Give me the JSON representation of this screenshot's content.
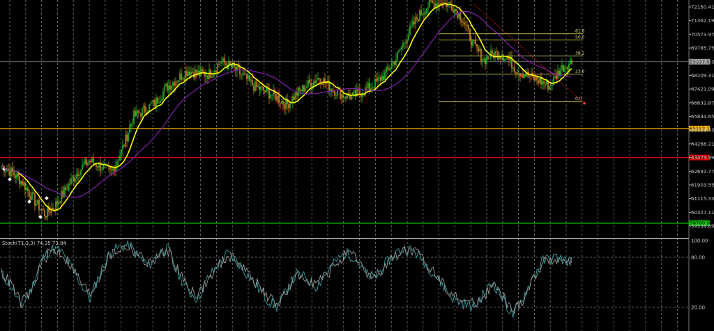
{
  "chart_data": [
    {
      "type": "candlestick",
      "instrument_note": "",
      "ylim": [
        59538.89,
        72500
      ],
      "price_ticks": [
        "72150.41",
        "71362.19",
        "70573.97",
        "69785.75",
        "68997.53",
        "68209.31",
        "67421.09",
        "66632.87",
        "65844.65",
        "65056.43",
        "64268.21",
        "63479.99",
        "62691.77",
        "61903.55",
        "61115.33",
        "60327.11",
        "59538.89"
      ],
      "current_price": "68997.53",
      "horizontal_levels": [
        {
          "price": "65152.18",
          "color": "#f0b400"
        },
        {
          "price": "63479.99",
          "color": "#e00000"
        },
        {
          "price": "59700.00",
          "color": "#00c000"
        }
      ],
      "fibonacci": {
        "levels": [
          {
            "label": "61.8",
            "price": 70600
          },
          {
            "label": "50.0",
            "price": 70250
          },
          {
            "label": "38.2",
            "price": 69330
          },
          {
            "label": "23.6",
            "price": 68290
          },
          {
            "label": "0.0",
            "price": 66700
          }
        ]
      },
      "moving_averages": [
        {
          "color": "#ffff00"
        },
        {
          "color": "#7a1fa0"
        }
      ],
      "series_anchor_prices": [
        63000,
        62600,
        62000,
        61000,
        60200,
        60800,
        61800,
        62700,
        63300,
        63000,
        62600,
        63900,
        65800,
        66200,
        66600,
        67500,
        68000,
        68500,
        68300,
        68300,
        69000,
        68700,
        68200,
        67600,
        67300,
        67000,
        66500,
        67200,
        67700,
        68100,
        67500,
        67100,
        67000,
        67300,
        67700,
        68300,
        69200,
        70500,
        71600,
        72300,
        72400,
        72300,
        71500,
        70000,
        69100,
        69500,
        69300,
        68500,
        68200,
        67900,
        67600,
        68600,
        69000
      ]
    },
    {
      "type": "line",
      "indicator_label": "Stoch(71,3,3) 74.35 73.84",
      "ylim": [
        0,
        100
      ],
      "ticks": [
        "100.00",
        "80.00",
        "20.00"
      ],
      "levels": [
        80,
        20
      ],
      "series": [
        {
          "color": "#3aa0a0",
          "values": [
            60,
            45,
            20,
            40,
            75,
            90,
            88,
            70,
            50,
            30,
            60,
            85,
            92,
            95,
            80,
            70,
            85,
            90,
            60,
            40,
            30,
            55,
            70,
            85,
            75,
            60,
            45,
            30,
            20,
            40,
            60,
            55,
            45,
            60,
            75,
            85,
            80,
            60,
            55,
            70,
            85,
            90,
            88,
            75,
            60,
            45,
            30,
            25,
            20,
            35,
            50,
            30,
            10,
            30,
            55,
            75,
            80,
            78,
            74
          ]
        },
        {
          "color": "#9a9a9a",
          "values": [
            62,
            48,
            25,
            38,
            70,
            88,
            86,
            72,
            52,
            35,
            58,
            82,
            90,
            93,
            82,
            72,
            82,
            88,
            63,
            45,
            35,
            52,
            68,
            82,
            76,
            62,
            48,
            34,
            24,
            38,
            57,
            56,
            48,
            58,
            72,
            82,
            80,
            63,
            56,
            68,
            82,
            88,
            87,
            76,
            62,
            48,
            34,
            28,
            24,
            33,
            47,
            33,
            14,
            28,
            52,
            72,
            78,
            77,
            74
          ]
        }
      ]
    }
  ]
}
